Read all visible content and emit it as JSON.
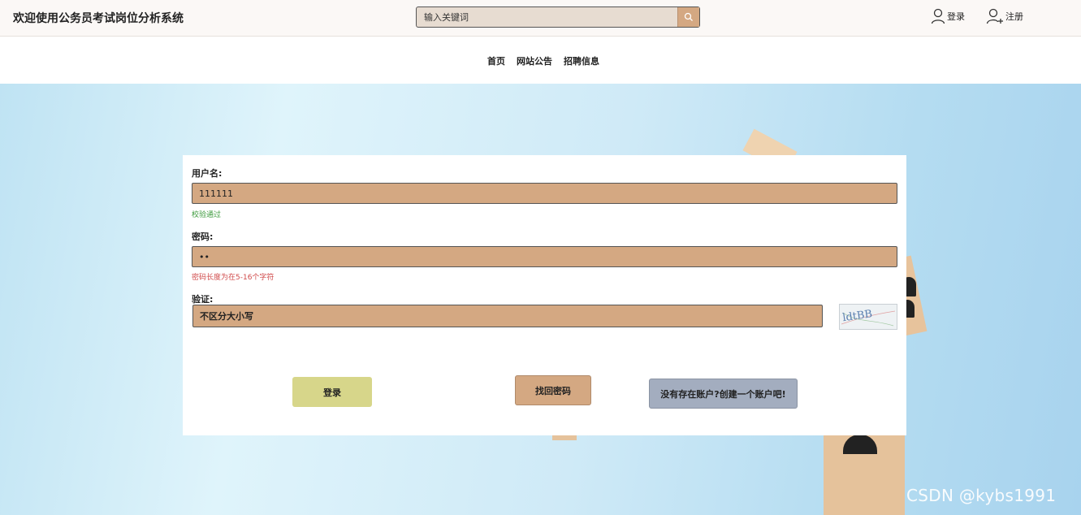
{
  "header": {
    "site_title": "欢迎使用公务员考试岗位分析系统",
    "search_placeholder": "输入关键词",
    "login_label": "登录",
    "register_label": "注册"
  },
  "nav": {
    "items": [
      "首页",
      "网站公告",
      "招聘信息"
    ]
  },
  "form": {
    "username_label": "用户名:",
    "username_value": "111111",
    "username_hint": "校验通过",
    "password_label": "密码:",
    "password_value": "••",
    "password_hint": "密码长度为在5-16个字符",
    "captcha_label": "验证:",
    "captcha_placeholder": "不区分大小写",
    "captcha_text": "ldtBB"
  },
  "buttons": {
    "login": "登录",
    "forgot_password": "找回密码",
    "create_account": "没有存在账户?创建一个账户吧!"
  },
  "watermark": "CSDN @kybs1991",
  "colors": {
    "accent": "#d4a882",
    "login_button": "#d7d68a",
    "register_button": "#a3adbf",
    "hint_ok": "#3c9a3c",
    "hint_error": "#d04a4a"
  }
}
